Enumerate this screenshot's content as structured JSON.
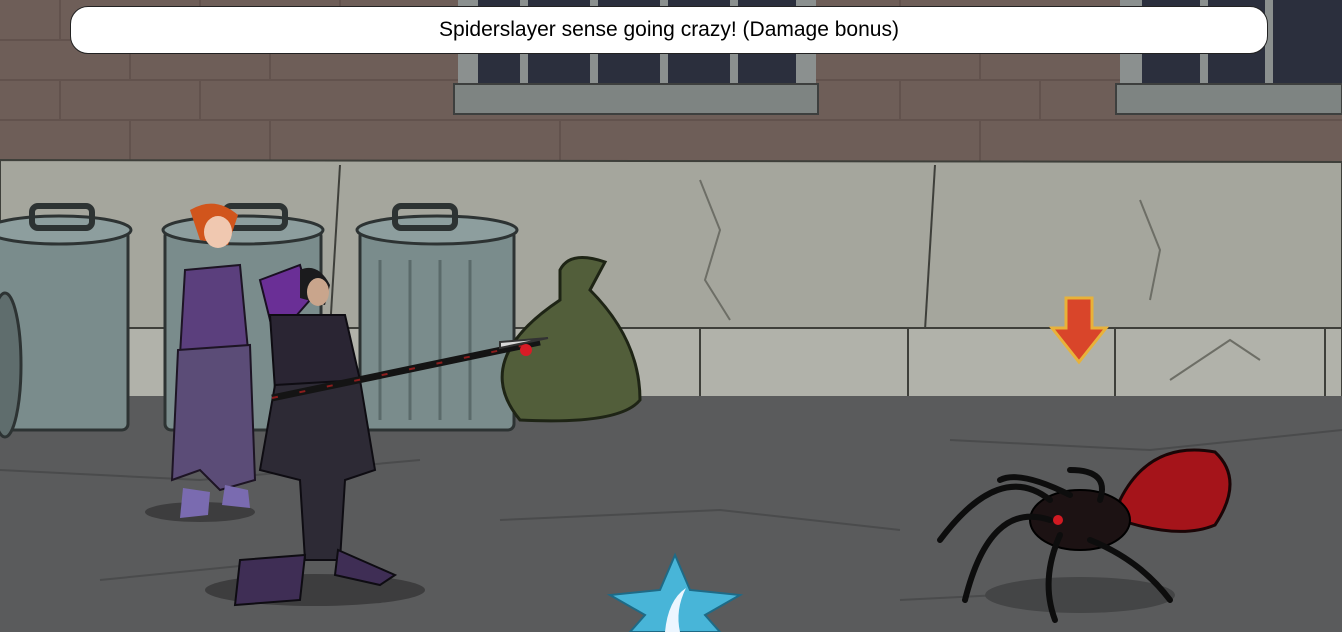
{
  "banner": {
    "message": "Spiderslayer sense going crazy! (Damage bonus)"
  },
  "scene": {
    "setting": "city alley",
    "characters": [
      {
        "role": "ally",
        "description": "orange-haired companion in purple outfit"
      },
      {
        "role": "player",
        "description": "armored hero in dark crystal armor wielding spear"
      }
    ],
    "enemy": {
      "description": "black and red giant spider"
    },
    "target_marker_icon": "red-down-arrow-icon",
    "effect_icon": "blue-crystal-burst-icon"
  },
  "colors": {
    "wall": "#6e5e58",
    "sidewalk": "#a4a59c",
    "street": "#5a5b5c",
    "banner_bg": "#ffffff",
    "target_arrow": "#d9452a",
    "spider_abdomen": "#a5141a"
  }
}
